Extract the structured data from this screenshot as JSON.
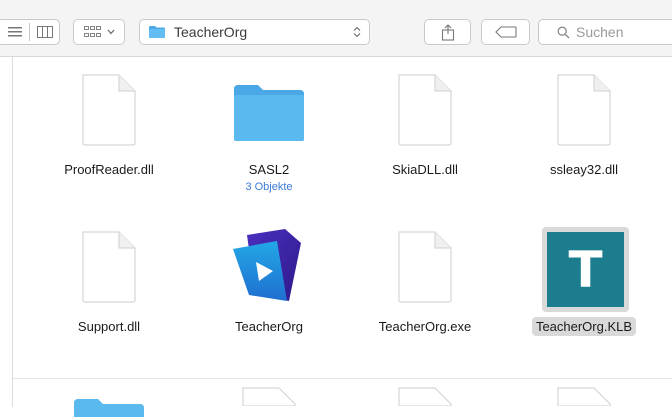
{
  "toolbar": {
    "path_label": "TeacherOrg",
    "search_placeholder": "Suchen"
  },
  "files": [
    {
      "name": "ProofReader.dll",
      "kind": "doc"
    },
    {
      "name": "SASL2",
      "kind": "folder",
      "sub": "3 Objekte"
    },
    {
      "name": "SkiaDLL.dll",
      "kind": "doc"
    },
    {
      "name": "ssleay32.dll",
      "kind": "doc"
    },
    {
      "name": "Support.dll",
      "kind": "doc"
    },
    {
      "name": "TeacherOrg",
      "kind": "app"
    },
    {
      "name": "TeacherOrg.exe",
      "kind": "doc"
    },
    {
      "name": "TeacherOrg.KLB",
      "kind": "klb",
      "selected": true,
      "icon_letter": "T"
    }
  ],
  "colors": {
    "folder": "#5ab9ef",
    "klb_bg": "#1c7d8f",
    "selection": "#d9d9d9"
  }
}
